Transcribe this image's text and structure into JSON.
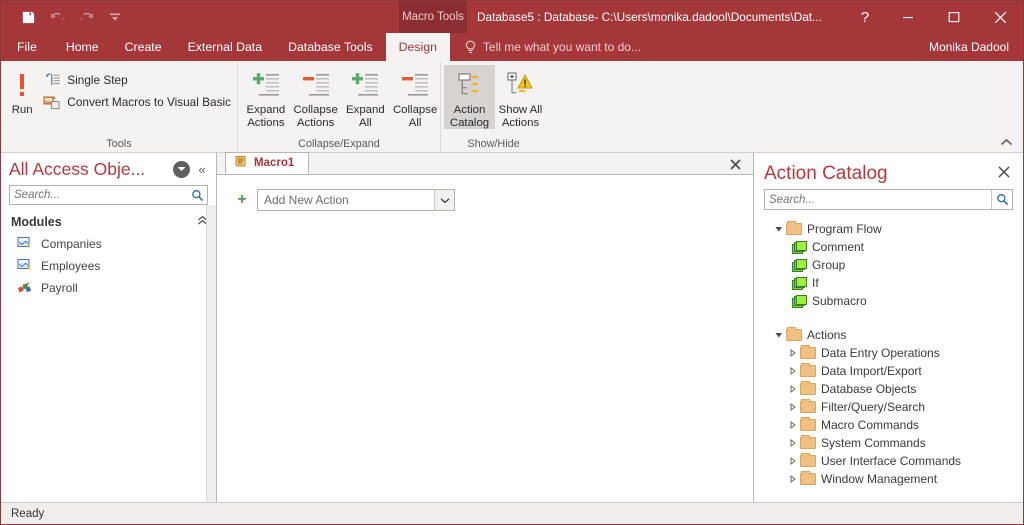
{
  "titlebar": {
    "quick_access": [
      {
        "name": "save-button",
        "icon": "save-icon",
        "enabled": true
      },
      {
        "name": "undo-button",
        "icon": "undo-icon",
        "enabled": false
      },
      {
        "name": "redo-button",
        "icon": "redo-icon",
        "enabled": false
      },
      {
        "name": "customize-quick-access-button",
        "icon": "chevron-down-icon",
        "enabled": true
      }
    ],
    "contextual_tools": "Macro Tools",
    "document_title": "Database5 : Database- C:\\Users\\monika.dadool\\Documents\\Dat...",
    "help_label": "?",
    "minimize_label": "minimize-icon",
    "maximize_label": "maximize-icon",
    "close_label": "close-icon"
  },
  "ribbon_tabs": {
    "items": [
      {
        "label": "File",
        "active": false
      },
      {
        "label": "Home",
        "active": false
      },
      {
        "label": "Create",
        "active": false
      },
      {
        "label": "External Data",
        "active": false
      },
      {
        "label": "Database Tools",
        "active": false
      },
      {
        "label": "Design",
        "active": true
      }
    ],
    "tell_me": "Tell me what you want to do...",
    "user_name": "Monika Dadool"
  },
  "ribbon": {
    "groups": [
      {
        "label": "Tools",
        "big_buttons": [
          {
            "label": "Run",
            "icon": "run-exclamation-icon"
          }
        ],
        "small_buttons": [
          {
            "label": "Single Step",
            "icon": "single-step-icon"
          },
          {
            "label": "Convert Macros to Visual Basic",
            "icon": "convert-macros-icon"
          }
        ]
      },
      {
        "label": "Collapse/Expand",
        "big_buttons": [
          {
            "label_line1": "Expand",
            "label_line2": "Actions",
            "icon": "expand-actions-icon"
          },
          {
            "label_line1": "Collapse",
            "label_line2": "Actions",
            "icon": "collapse-actions-icon"
          },
          {
            "label_line1": "Expand",
            "label_line2": "All",
            "icon": "expand-all-icon"
          },
          {
            "label_line1": "Collapse",
            "label_line2": "All",
            "icon": "collapse-all-icon"
          }
        ]
      },
      {
        "label": "Show/Hide",
        "big_buttons": [
          {
            "label_line1": "Action",
            "label_line2": "Catalog",
            "icon": "action-catalog-icon",
            "selected": true
          },
          {
            "label_line1": "Show All",
            "label_line2": "Actions",
            "icon": "show-all-actions-icon",
            "selected": false
          }
        ]
      }
    ],
    "collapse_ribbon": "collapse-ribbon-icon"
  },
  "nav_pane": {
    "title": "All Access Obje...",
    "menu_icon": "chevron-down-icon",
    "collapse_icon": "double-chevron-left-icon",
    "search_placeholder": "Search...",
    "search_value": "",
    "groups": [
      {
        "label": "Modules",
        "collapse_icon": "double-chevron-up-icon",
        "items": [
          {
            "label": "Companies",
            "icon": "module-icon"
          },
          {
            "label": "Employees",
            "icon": "module-icon"
          },
          {
            "label": "Payroll",
            "icon": "macro-icon"
          }
        ]
      }
    ]
  },
  "document": {
    "tab_label": "Macro1",
    "tab_icon": "macro-scroll-icon",
    "close_icon": "close-icon",
    "add_new_action": {
      "plus_icon": "plus-icon",
      "value": "Add New Action",
      "dropdown_icon": "chevron-down-icon"
    }
  },
  "action_catalog": {
    "title": "Action Catalog",
    "close_icon": "close-icon",
    "search_placeholder": "Search...",
    "search_value": "",
    "search_icon": "search-icon",
    "tree": [
      {
        "label": "Program Flow",
        "icon": "folder-icon",
        "expanded": true,
        "children": [
          {
            "label": "Comment",
            "icon": "program-flow-item-icon"
          },
          {
            "label": "Group",
            "icon": "program-flow-item-icon"
          },
          {
            "label": "If",
            "icon": "program-flow-item-icon"
          },
          {
            "label": "Submacro",
            "icon": "program-flow-item-icon"
          }
        ]
      },
      {
        "label": "Actions",
        "icon": "folder-icon",
        "expanded": true,
        "children": [
          {
            "label": "Data Entry Operations",
            "icon": "folder-icon",
            "expanded": false
          },
          {
            "label": "Data Import/Export",
            "icon": "folder-icon",
            "expanded": false
          },
          {
            "label": "Database Objects",
            "icon": "folder-icon",
            "expanded": false
          },
          {
            "label": "Filter/Query/Search",
            "icon": "folder-icon",
            "expanded": false
          },
          {
            "label": "Macro Commands",
            "icon": "folder-icon",
            "expanded": false
          },
          {
            "label": "System Commands",
            "icon": "folder-icon",
            "expanded": false
          },
          {
            "label": "User Interface Commands",
            "icon": "folder-icon",
            "expanded": false
          },
          {
            "label": "Window Management",
            "icon": "folder-icon",
            "expanded": false
          }
        ]
      }
    ]
  },
  "status_bar": {
    "text": "Ready"
  },
  "colors": {
    "accent": "#a4373a",
    "accent_dark": "#8c2e31",
    "ribbon_bg": "#f4f3f2",
    "title_text": "#b03a3d"
  }
}
